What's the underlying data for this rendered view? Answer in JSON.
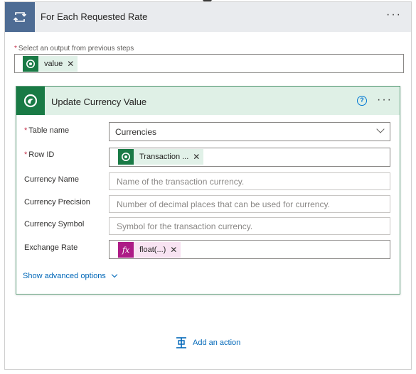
{
  "loop": {
    "title": "For Each Requested Rate",
    "icon": "loop-icon",
    "more": "···"
  },
  "select_output": {
    "required_mark": "*",
    "label": "Select an output from previous steps",
    "token": {
      "label": "value",
      "icon": "dataverse-icon",
      "remove": "✕"
    }
  },
  "action": {
    "title": "Update Currency Value",
    "icon": "dataverse-icon",
    "help": "?",
    "more": "···",
    "fields": {
      "table_name": {
        "required_mark": "*",
        "label": "Table name",
        "value": "Currencies"
      },
      "row_id": {
        "required_mark": "*",
        "label": "Row ID",
        "token_label": "Transaction ...",
        "remove": "✕"
      },
      "currency_name": {
        "label": "Currency Name",
        "placeholder": "Name of the transaction currency."
      },
      "currency_precision": {
        "label": "Currency Precision",
        "placeholder": "Number of decimal places that can be used for currency."
      },
      "currency_symbol": {
        "label": "Currency Symbol",
        "placeholder": "Symbol for the transaction currency."
      },
      "exchange_rate": {
        "label": "Exchange Rate",
        "token_icon_text": "fx",
        "token_label": "float(...)",
        "remove": "✕"
      }
    },
    "advanced_link": "Show advanced options"
  },
  "add_action": {
    "label": "Add an action",
    "icon": "add-action-icon"
  },
  "colors": {
    "loop_accent": "#4e6c94",
    "dataverse_green": "#197a45",
    "expression_pink": "#ad1b86",
    "link_blue": "#0067b8"
  }
}
